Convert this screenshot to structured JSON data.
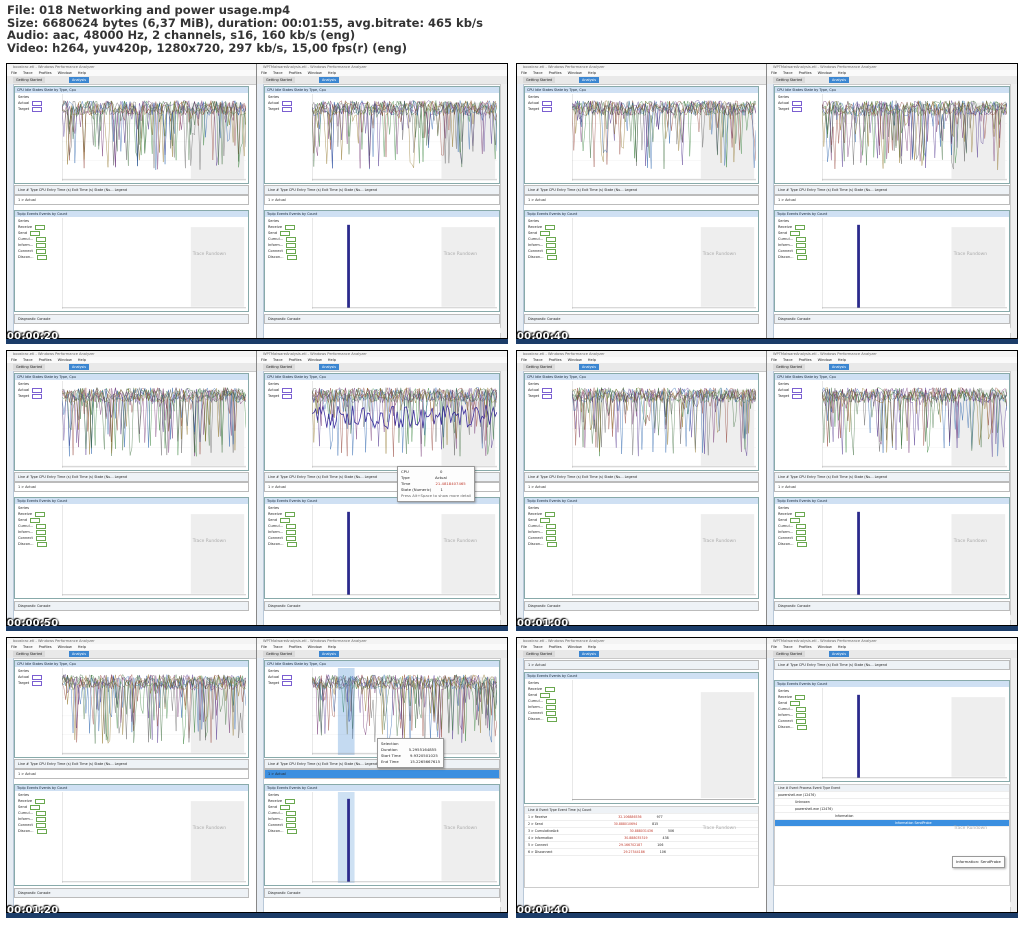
{
  "info": {
    "file": "File: 018 Networking and power usage.mp4",
    "size": "Size: 6680624 bytes (6,37 MiB), duration: 00:01:55, avg.bitrate: 465 kb/s",
    "audio": "Audio: aac, 48000 Hz, 2 channels, s16, 160 kb/s (eng)",
    "video": "Video: h264, yuv420p, 1280x720, 297 kb/s, 15,00 fps(r) (eng)"
  },
  "app": {
    "left_title": "boostrac.etl - Windows Performance Analyzer",
    "right_title": "WPTMalwareAnalysis.etl - Windows Performance Analyzer",
    "menu": [
      "File",
      "Trace",
      "Profiles",
      "Window",
      "Help"
    ],
    "tab_getting_started": "Getting Started",
    "tab_analysis": "Analysis",
    "cpu_header": "CPU Idle States  State by Type, Cpu",
    "events_header": "TcpIp Events  Events by Count",
    "series_label": "Series",
    "cpu_series": [
      "Actual",
      "Target"
    ],
    "event_series": [
      "Receive",
      "Send",
      "Cumul...",
      "Inform...",
      "Connect",
      "Discon..."
    ],
    "table_head": "Line #   Type     CPU     Entry Time (s)     Exit Time (s)    State (Nu...    Legend",
    "table_row": "1  > Actual",
    "watermark_text": "Trace Rundown",
    "linkedin": "Linked in",
    "diag": "Diagnostic Console"
  },
  "frames": [
    {
      "time": "00:00:20"
    },
    {
      "time": "00:00:40"
    },
    {
      "time": "00:00:50"
    },
    {
      "time": "00:01:00"
    },
    {
      "time": "00:01:20"
    },
    {
      "time": "00:01:40"
    }
  ],
  "tooltip": {
    "cpu": "CPU",
    "cpu_v": "0",
    "type": "Type",
    "type_v": "Actual",
    "time": "Time",
    "time_v": "21.4818407465",
    "state": "State (Numeric)",
    "state_v": "1",
    "hint": "Press Alt+Space to show more detail"
  },
  "selection": {
    "title": "Selection",
    "duration": "Duration",
    "duration_v": "5.2955164855",
    "start": "Start Time",
    "start_v": "9.9320501025",
    "end": "End Time",
    "end_v": "15.2265667615"
  },
  "event_table": {
    "head": "Line #  Event Type                Event                       Time (s)           Count",
    "rows": [
      {
        "label": "1  > Receive",
        "time": "32.106886536",
        "count": "977"
      },
      {
        "label": "2  > Send",
        "time": "30.888010694",
        "count": "815"
      },
      {
        "label": "3  > CumulativeAck",
        "time": "30.888031436",
        "count": "506"
      },
      {
        "label": "4  > Information",
        "time": "30.888035319",
        "count": "438"
      },
      {
        "label": "5  > Connect",
        "time": "29.166702187",
        "count": "106"
      },
      {
        "label": "6  > Disconnect",
        "time": "29.27544186",
        "count": "106"
      }
    ]
  },
  "process_table": {
    "head": "Line #   Event Process          Event Type       Event",
    "proc": "powershell.exe (12476)",
    "unknown": "Unknown",
    "ps": "powershell.exe (12476)",
    "info": "Information",
    "sel": "Information SendProbe",
    "tip": "Information: SendProbe"
  },
  "colors": {
    "accent": "#3b86d1",
    "series_purple": "#7b5fd1",
    "bar_navy": "#2b2a8c",
    "band": "#1b3c68"
  }
}
